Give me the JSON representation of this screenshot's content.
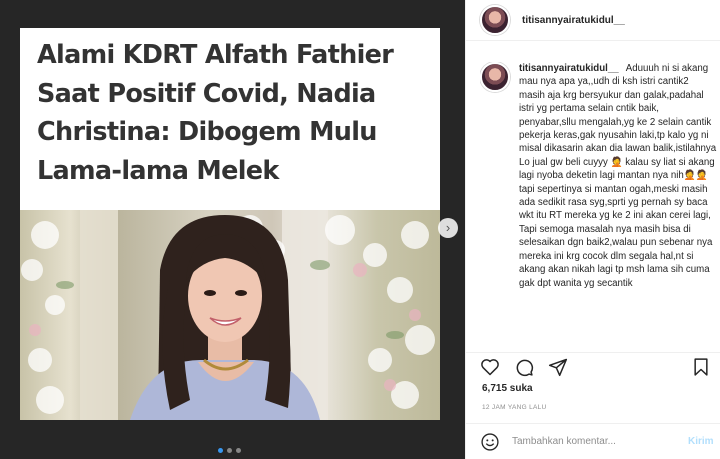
{
  "post": {
    "headline": "Alami KDRT Alfath Fathier Saat Positif Covid, Nadia Christina: Dibogem Mulu Lama-lama Melek",
    "carousel_next_icon": "chevron-right-icon",
    "carousel_dots": 3,
    "carousel_active_dot": 0
  },
  "header": {
    "username": "titisannyairatukidul__"
  },
  "caption": {
    "username": "titisannyairatukidul__",
    "text": "Aduuuh ni si akang mau nya apa ya,,udh di ksh istri cantik2 masih aja krg bersyukur dan galak,padahal istri yg pertama selain cntik baik, penyabar,sllu mengalah,yg ke 2 selain cantik pekerja keras,gak nyusahin laki,tp kalo yg ni misal dikasarin akan dia lawan balik,istilahnya Lo jual gw beli cuyyy 🤦 kalau sy liat si akang lagi nyoba deketin lagi mantan nya nih🤦🤦 tapi sepertinya si mantan ogah,meski masih ada sedikit rasa syg,sprti yg pernah sy baca wkt itu RT mereka yg ke 2 ini akan cerei lagi, Tapi semoga masalah nya masih bisa di selesaikan dgn baik2,walau pun sebenar nya mereka ini krg cocok dlm segala hal,nt si akang akan nikah lagi tp msh lama sih cuma gak dpt wanita yg secantik"
  },
  "actions": {
    "icons": [
      "heart-icon",
      "comment-icon",
      "share-icon",
      "bookmark-icon"
    ]
  },
  "likes": "6,715 suka",
  "timestamp": "12 JAM YANG LALU",
  "comment": {
    "placeholder": "Tambahkan komentar...",
    "send_label": "Kirim"
  },
  "colors": {
    "accent": "#3897f0",
    "send_disabled": "#b2dffc",
    "media_bg": "#262626"
  }
}
